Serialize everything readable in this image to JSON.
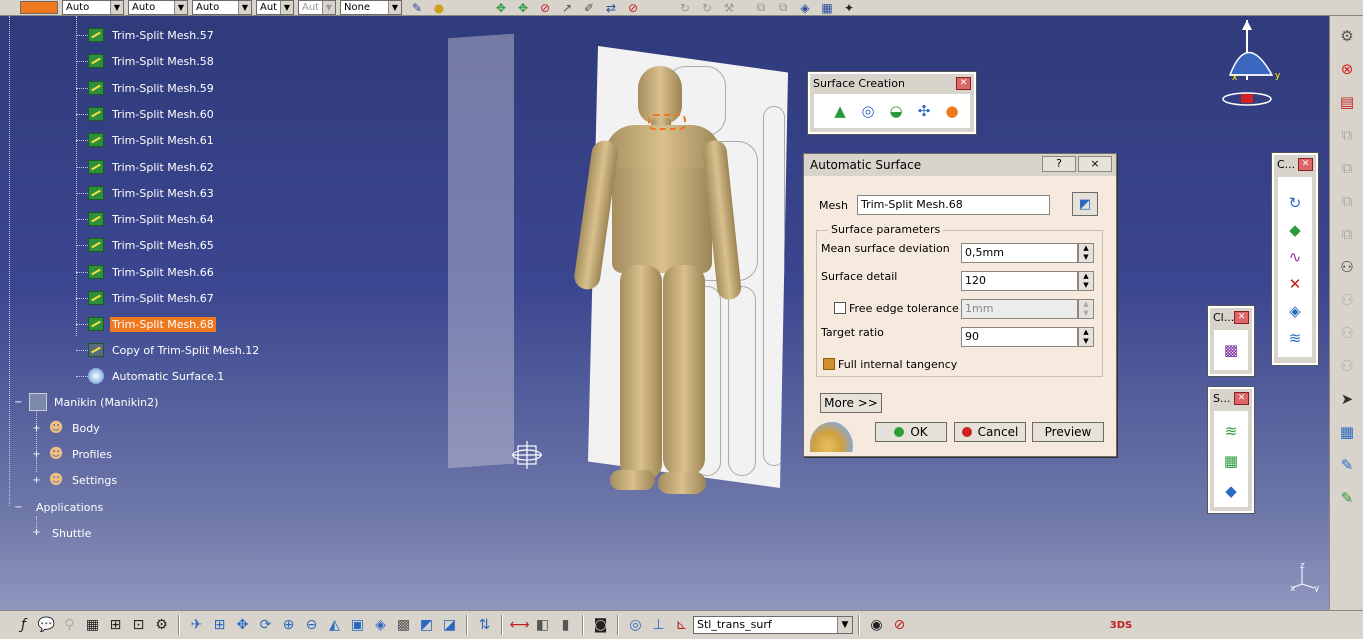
{
  "toolbar": {
    "combos": [
      "Auto",
      "Auto",
      "Auto",
      "Aut",
      "Aut",
      "None"
    ]
  },
  "tree": {
    "meshes": [
      "Trim-Split Mesh.57",
      "Trim-Split Mesh.58",
      "Trim-Split Mesh.59",
      "Trim-Split Mesh.60",
      "Trim-Split Mesh.61",
      "Trim-Split Mesh.62",
      "Trim-Split Mesh.63",
      "Trim-Split Mesh.64",
      "Trim-Split Mesh.65",
      "Trim-Split Mesh.66",
      "Trim-Split Mesh.67",
      "Trim-Split Mesh.68"
    ],
    "copy_item": "Copy of Trim-Split Mesh.12",
    "auto_surface": "Automatic Surface.1",
    "manikin": "Manikin (Manikin2)",
    "manikin_children": [
      "Body",
      "Profiles",
      "Settings"
    ],
    "applications": "Applications",
    "shuttle": "Shuttle"
  },
  "surface_creation": {
    "title": "Surface Creation"
  },
  "small_palettes": {
    "c_title": "C...",
    "cl_title": "Cl...",
    "s_title": "S..."
  },
  "dialog": {
    "title": "Automatic Surface",
    "help": "?",
    "close": "×",
    "mesh_label": "Mesh",
    "mesh_value": "Trim-Split Mesh.68",
    "group_title": "Surface parameters",
    "mean_dev_label": "Mean surface deviation",
    "mean_dev_value": "0,5mm",
    "detail_label": "Surface detail",
    "detail_value": "120",
    "free_edge_label": "Free edge tolerance",
    "free_edge_value": "1mm",
    "target_label": "Target ratio",
    "target_value": "90",
    "tangency_label": "Full internal tangency",
    "more": "More >>",
    "ok": "OK",
    "cancel": "Cancel",
    "preview": "Preview"
  },
  "bottom": {
    "combo": "Stl_trans_surf"
  },
  "axis": {
    "z": "z",
    "x": "x",
    "y": "y"
  }
}
